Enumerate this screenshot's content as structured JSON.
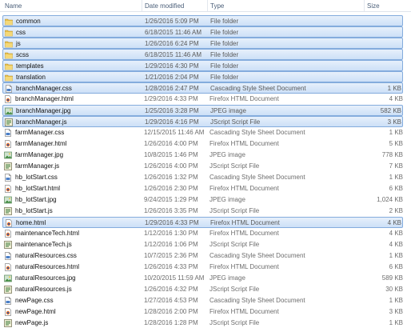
{
  "columns": {
    "name": "Name",
    "date": "Date modified",
    "type": "Type",
    "size": "Size"
  },
  "colors": {
    "folder": "#e8c04a",
    "selection_border": "#84acdd",
    "selection_fill": "#d6e6f8"
  },
  "files": [
    {
      "name": "common",
      "date": "1/26/2016 5:09 PM",
      "type": "File folder",
      "size": "",
      "icon": "folder-icon",
      "selected": true
    },
    {
      "name": "css",
      "date": "6/18/2015 11:46 AM",
      "type": "File folder",
      "size": "",
      "icon": "folder-icon",
      "selected": true
    },
    {
      "name": "js",
      "date": "1/26/2016 6:24 PM",
      "type": "File folder",
      "size": "",
      "icon": "folder-icon",
      "selected": true
    },
    {
      "name": "scss",
      "date": "6/18/2015 11:46 AM",
      "type": "File folder",
      "size": "",
      "icon": "folder-icon",
      "selected": true
    },
    {
      "name": "templates",
      "date": "1/29/2016 4:30 PM",
      "type": "File folder",
      "size": "",
      "icon": "folder-icon",
      "selected": true
    },
    {
      "name": "translation",
      "date": "1/21/2016 2:04 PM",
      "type": "File folder",
      "size": "",
      "icon": "folder-icon",
      "selected": true
    },
    {
      "name": "branchManager.css",
      "date": "1/28/2016 2:47 PM",
      "type": "Cascading Style Sheet Document",
      "size": "1 KB",
      "icon": "css-file-icon",
      "selected": true
    },
    {
      "name": "branchManager.html",
      "date": "1/29/2016 4:33 PM",
      "type": "Firefox HTML Document",
      "size": "4 KB",
      "icon": "html-file-icon",
      "selected": false
    },
    {
      "name": "branchManager.jpg",
      "date": "1/25/2016 3:28 PM",
      "type": "JPEG image",
      "size": "582 KB",
      "icon": "image-file-icon",
      "selected": true
    },
    {
      "name": "branchManager.js",
      "date": "1/29/2016 4:16 PM",
      "type": "JScript Script File",
      "size": "3 KB",
      "icon": "script-file-icon",
      "selected": true
    },
    {
      "name": "farmManager.css",
      "date": "12/15/2015 11:46 AM",
      "type": "Cascading Style Sheet Document",
      "size": "1 KB",
      "icon": "css-file-icon",
      "selected": false
    },
    {
      "name": "farmManager.html",
      "date": "1/26/2016 4:00 PM",
      "type": "Firefox HTML Document",
      "size": "5 KB",
      "icon": "html-file-icon",
      "selected": false
    },
    {
      "name": "farmManager.jpg",
      "date": "10/8/2015 1:46 PM",
      "type": "JPEG image",
      "size": "778 KB",
      "icon": "image-file-icon",
      "selected": false
    },
    {
      "name": "farmManager.js",
      "date": "1/26/2016 4:00 PM",
      "type": "JScript Script File",
      "size": "7 KB",
      "icon": "script-file-icon",
      "selected": false
    },
    {
      "name": "hb_lotStart.css",
      "date": "1/26/2016 1:32 PM",
      "type": "Cascading Style Sheet Document",
      "size": "1 KB",
      "icon": "css-file-icon",
      "selected": false
    },
    {
      "name": "hb_lotStart.html",
      "date": "1/26/2016 2:30 PM",
      "type": "Firefox HTML Document",
      "size": "6 KB",
      "icon": "html-file-icon",
      "selected": false
    },
    {
      "name": "hb_lotStart.jpg",
      "date": "9/24/2015 1:29 PM",
      "type": "JPEG image",
      "size": "1,024 KB",
      "icon": "image-file-icon",
      "selected": false
    },
    {
      "name": "hb_lotStart.js",
      "date": "1/26/2016 3:35 PM",
      "type": "JScript Script File",
      "size": "2 KB",
      "icon": "script-file-icon",
      "selected": false
    },
    {
      "name": "home.html",
      "date": "1/29/2016 4:33 PM",
      "type": "Firefox HTML Document",
      "size": "4 KB",
      "icon": "html-file-icon",
      "selected": true
    },
    {
      "name": "maintenanceTech.html",
      "date": "1/12/2016 1:30 PM",
      "type": "Firefox HTML Document",
      "size": "4 KB",
      "icon": "html-file-icon",
      "selected": false
    },
    {
      "name": "maintenanceTech.js",
      "date": "1/12/2016 1:06 PM",
      "type": "JScript Script File",
      "size": "4 KB",
      "icon": "script-file-icon",
      "selected": false
    },
    {
      "name": "naturalResources.css",
      "date": "10/7/2015 2:36 PM",
      "type": "Cascading Style Sheet Document",
      "size": "1 KB",
      "icon": "css-file-icon",
      "selected": false
    },
    {
      "name": "naturalResources.html",
      "date": "1/26/2016 4:33 PM",
      "type": "Firefox HTML Document",
      "size": "6 KB",
      "icon": "html-file-icon",
      "selected": false
    },
    {
      "name": "naturalResources.jpg",
      "date": "10/20/2015 11:59 AM",
      "type": "JPEG image",
      "size": "589 KB",
      "icon": "image-file-icon",
      "selected": false
    },
    {
      "name": "naturalResources.js",
      "date": "1/26/2016 4:32 PM",
      "type": "JScript Script File",
      "size": "30 KB",
      "icon": "script-file-icon",
      "selected": false
    },
    {
      "name": "newPage.css",
      "date": "1/27/2016 4:53 PM",
      "type": "Cascading Style Sheet Document",
      "size": "1 KB",
      "icon": "css-file-icon",
      "selected": false
    },
    {
      "name": "newPage.html",
      "date": "1/28/2016 2:00 PM",
      "type": "Firefox HTML Document",
      "size": "3 KB",
      "icon": "html-file-icon",
      "selected": false
    },
    {
      "name": "newPage.js",
      "date": "1/28/2016 1:28 PM",
      "type": "JScript Script File",
      "size": "1 KB",
      "icon": "script-file-icon",
      "selected": false
    }
  ]
}
